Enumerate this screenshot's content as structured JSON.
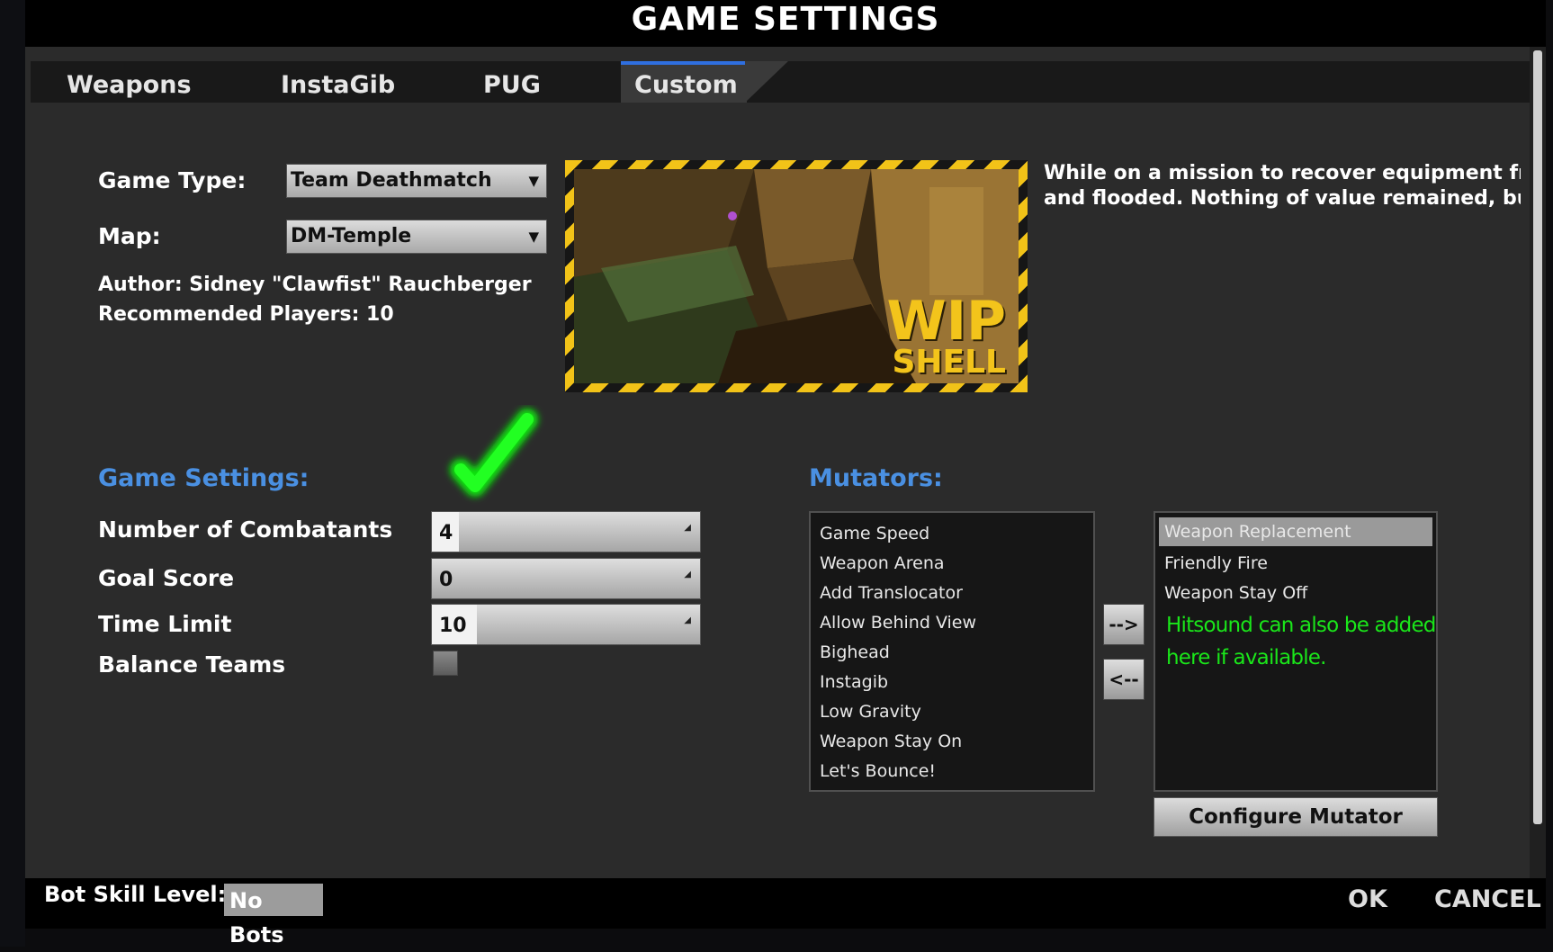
{
  "window": {
    "title": "GAME SETTINGS"
  },
  "tabs": [
    {
      "label": "Weapons",
      "active": false
    },
    {
      "label": "InstaGib",
      "active": false
    },
    {
      "label": "PUG",
      "active": false
    },
    {
      "label": "Custom",
      "active": true
    }
  ],
  "map_section": {
    "game_type_label": "Game Type:",
    "game_type_value": "Team Deathmatch",
    "map_label": "Map:",
    "map_value": "DM-Temple",
    "author": "Author: Sidney \"Clawfist\" Rauchberger",
    "recommended_players": "Recommended Players: 10",
    "preview_overlay_line1": "WIP",
    "preview_overlay_line2": "SHELL",
    "description_line1": "While on a mission to recover equipment from t",
    "description_line2": "and flooded.  Nothing of value remained, but th"
  },
  "game_settings": {
    "heading": "Game Settings:",
    "combatants_label": "Number of Combatants",
    "combatants_value": "4",
    "goal_score_label": "Goal Score",
    "goal_score_value": "0",
    "time_limit_label": "Time Limit",
    "time_limit_value": "10",
    "balance_teams_label": "Balance Teams",
    "balance_teams_checked": false
  },
  "mutators": {
    "heading": "Mutators:",
    "available": [
      "Game Speed",
      "Weapon Arena",
      "Add Translocator",
      "Allow Behind View",
      "Bighead",
      "Instagib",
      "Low Gravity",
      "Weapon Stay On",
      "Let's Bounce!"
    ],
    "selected": [
      "Weapon Replacement",
      "Friendly Fire",
      "Weapon Stay Off"
    ],
    "highlighted": "Weapon Replacement",
    "hint_line1": "Hitsound can also be added",
    "hint_line2": "here if available.",
    "add_button": "-->",
    "remove_button": "<--",
    "configure_button": "Configure Mutator"
  },
  "footer": {
    "bot_skill_label": "Bot Skill Level:",
    "bot_skill_value": "No Bots",
    "ok": "OK",
    "cancel": "CANCEL"
  },
  "colors": {
    "accent_blue": "#4a90e2",
    "hint_green": "#1ae61a",
    "hazard_yellow": "#f2c318",
    "panel_bg": "#2b2b2b"
  },
  "icons": {
    "dropdown_arrow": "▼",
    "spinner": "spin-arrows-icon",
    "annotation": "green-checkmark-icon"
  }
}
